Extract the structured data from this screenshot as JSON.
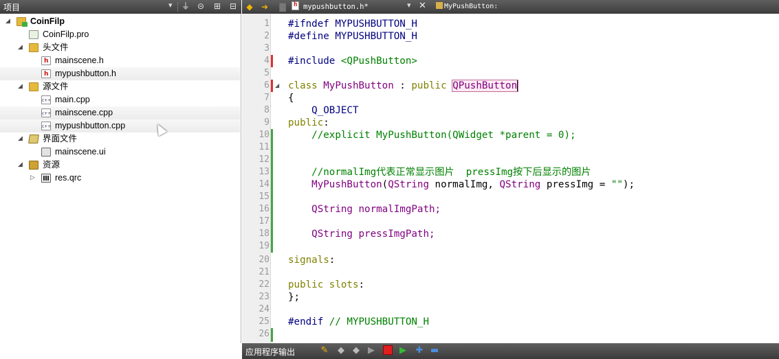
{
  "project_pane": {
    "title": "项目",
    "dropdown": "▾",
    "toolbar_icons": [
      "filter-icon",
      "link-icon",
      "split-icon",
      "close-pane-icon"
    ]
  },
  "tree": [
    {
      "label": "CoinFilp",
      "icon": "qt-project-folder-icon",
      "arrow": "◢",
      "bold": true
    },
    {
      "label": "CoinFilp.pro",
      "icon": "pro-file-icon",
      "arrow": ""
    },
    {
      "label": "头文件",
      "icon": "headers-folder-icon",
      "arrow": "◢"
    },
    {
      "label": "mainscene.h",
      "icon": "header-file-icon",
      "arrow": ""
    },
    {
      "label": "mypushbutton.h",
      "icon": "header-file-icon",
      "arrow": "",
      "highlight": true
    },
    {
      "label": "源文件",
      "icon": "sources-folder-icon",
      "arrow": "◢"
    },
    {
      "label": "main.cpp",
      "icon": "cpp-file-icon",
      "arrow": ""
    },
    {
      "label": "mainscene.cpp",
      "icon": "cpp-file-icon",
      "arrow": "",
      "highlight": true
    },
    {
      "label": "mypushbutton.cpp",
      "icon": "cpp-file-icon",
      "arrow": "",
      "highlight": true
    },
    {
      "label": "界面文件",
      "icon": "forms-folder-icon",
      "arrow": "◢"
    },
    {
      "label": "mainscene.ui",
      "icon": "ui-file-icon",
      "arrow": ""
    },
    {
      "label": "资源",
      "icon": "resources-folder-icon",
      "arrow": "◢"
    },
    {
      "label": "res.qrc",
      "icon": "qrc-file-icon",
      "arrow": "▷"
    }
  ],
  "editor": {
    "tab_filename": "mypushbutton.h*",
    "tab_dropdown": "▾",
    "tab_close": "✕",
    "symbol": "MyPushButton:"
  },
  "bottom_bar": {
    "label": "应用程序输出"
  },
  "code_lines": [
    {
      "n": "1"
    },
    {
      "n": "2"
    },
    {
      "n": "3"
    },
    {
      "n": "4"
    },
    {
      "n": "5"
    },
    {
      "n": "6"
    },
    {
      "n": "7"
    },
    {
      "n": "8"
    },
    {
      "n": "9"
    },
    {
      "n": "10"
    },
    {
      "n": "11"
    },
    {
      "n": "12"
    },
    {
      "n": "13"
    },
    {
      "n": "14"
    },
    {
      "n": "15"
    },
    {
      "n": "16"
    },
    {
      "n": "17"
    },
    {
      "n": "18"
    },
    {
      "n": "19"
    },
    {
      "n": "20"
    },
    {
      "n": "21"
    },
    {
      "n": "22"
    },
    {
      "n": "23"
    },
    {
      "n": "24"
    },
    {
      "n": "25"
    },
    {
      "n": "26"
    }
  ],
  "code": {
    "l1a": "#ifndef",
    "l1b": " MYPUSHBUTTON_H",
    "l2a": "#define",
    "l2b": " MYPUSHBUTTON_H",
    "l4a": "#include",
    "l4b": " <QPushButton>",
    "l6a": "class",
    "l6b": " MyPushButton",
    "l6c": " : ",
    "l6d": "public",
    "l6e": "QPushButton",
    "l7": "{",
    "l8": "    Q_OBJECT",
    "l9a": "public",
    "l9b": ":",
    "l10": "    //explicit MyPushButton(QWidget *parent = 0);",
    "l13": "    //normalImg代表正常显示图片  pressImg按下后显示的图片",
    "l14a": "    MyPushButton",
    "l14b": "(",
    "l14c": "QString",
    "l14d": " normalImg, ",
    "l14e": "QString",
    "l14f": " pressImg = ",
    "l14g": "\"\"",
    "l14h": ");",
    "l16a": "    QString",
    "l16b": " normalImgPath;",
    "l18a": "    QString",
    "l18b": " pressImgPath;",
    "l20a": "signals",
    "l20b": ":",
    "l22a": "public",
    "l22b": " slots",
    "l22c": ":",
    "l23": "};",
    "l25a": "#endif",
    "l25b": " // MYPUSHBUTTON_H"
  }
}
